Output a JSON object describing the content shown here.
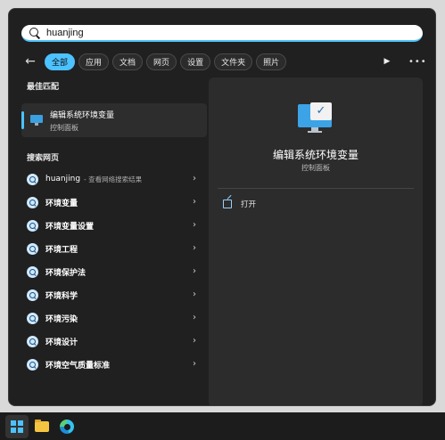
{
  "search": {
    "value": "huanjing"
  },
  "filters": {
    "back_icon": "back-arrow-icon",
    "chips": [
      "全部",
      "应用",
      "文档",
      "网页",
      "设置",
      "文件夹",
      "照片"
    ],
    "active": "全部",
    "play_icon": "play-icon",
    "more_icon": "more-icon"
  },
  "best_match": {
    "heading": "最佳匹配",
    "title": "编辑系统环境变量",
    "subtitle": "控制面板",
    "icon": "system-monitor-icon"
  },
  "web": {
    "heading": "搜索网页",
    "items": [
      {
        "label": "huanjing",
        "sub": "- 查看网络搜索结果"
      },
      {
        "label": "环境变量"
      },
      {
        "label": "环境变量设置"
      },
      {
        "label": "环境工程"
      },
      {
        "label": "环境保护法"
      },
      {
        "label": "环境科学"
      },
      {
        "label": "环境污染"
      },
      {
        "label": "环境设计"
      },
      {
        "label": "环境空气质量标准"
      }
    ]
  },
  "detail": {
    "title": "编辑系统环境变量",
    "subtitle": "控制面板",
    "actions": [
      {
        "label": "打开",
        "icon": "open-external-icon"
      }
    ]
  },
  "taskbar": {
    "items": [
      "windows-start-icon",
      "file-explorer-icon",
      "edge-browser-icon"
    ]
  },
  "colors": {
    "accent": "#4cc2ff",
    "panel": "#202020",
    "detail_bg": "#2c2c2c"
  }
}
